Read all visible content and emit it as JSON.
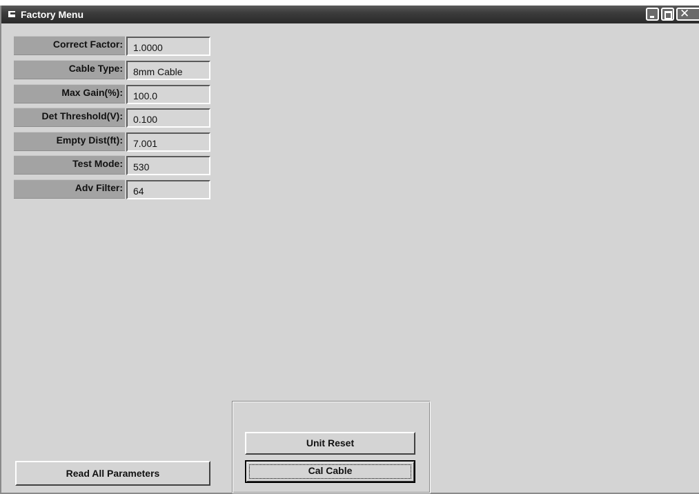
{
  "window": {
    "title": "Factory Menu",
    "controls": {
      "minimize": "minimize",
      "maximize": "maximize",
      "close": "✕"
    }
  },
  "params": [
    {
      "label": "Correct Factor:",
      "value": "1.0000"
    },
    {
      "label": "Cable Type:",
      "value": "8mm Cable"
    },
    {
      "label": "Max Gain(%):",
      "value": "100.0"
    },
    {
      "label": "Det Threshold(V):",
      "value": "0.100"
    },
    {
      "label": "Empty Dist(ft):",
      "value": "7.001"
    },
    {
      "label": "Test Mode:",
      "value": "530"
    },
    {
      "label": "Adv Filter:",
      "value": "64"
    }
  ],
  "buttons": {
    "read_all": "Read All Parameters",
    "unit_reset": "Unit Reset",
    "cal_cable": "Cal Cable"
  },
  "icons": {
    "window_icon": "window-icon",
    "minimize_icon": "minimize-icon",
    "maximize_icon": "maximize-icon",
    "close_icon": "close-icon"
  }
}
